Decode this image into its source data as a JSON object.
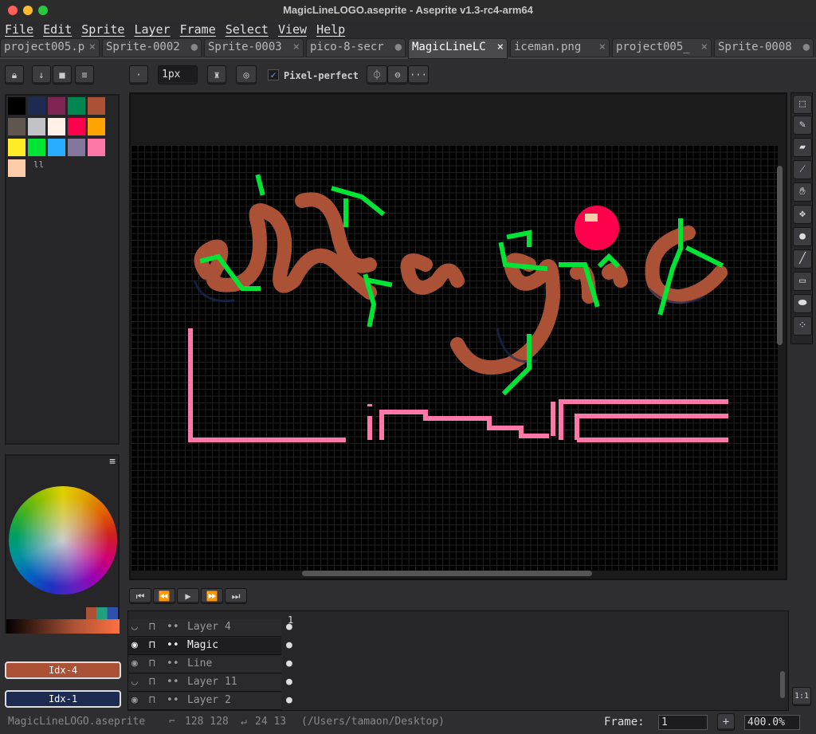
{
  "window": {
    "title": "MagicLineLOGO.aseprite - Aseprite v1.3-rc4-arm64"
  },
  "menu": [
    "File",
    "Edit",
    "Sprite",
    "Layer",
    "Frame",
    "Select",
    "View",
    "Help"
  ],
  "tabs": [
    {
      "label": "project005.p",
      "close": "×"
    },
    {
      "label": "Sprite-0002",
      "close": "●"
    },
    {
      "label": "Sprite-0003",
      "close": "×"
    },
    {
      "label": "pico-8-secr",
      "close": "●"
    },
    {
      "label": "MagicLineLC",
      "close": "×",
      "active": true
    },
    {
      "label": "iceman.png",
      "close": "×"
    },
    {
      "label": "project005_",
      "close": "×"
    },
    {
      "label": "Sprite-0008",
      "close": "●"
    }
  ],
  "toolbar": {
    "brush_size": "1px",
    "pixel_perfect_label": "Pixel-perfect",
    "pixel_perfect_checked": true,
    "more": "···"
  },
  "palette": {
    "colors": [
      "#000000",
      "#1d2b53",
      "#7e2553",
      "#008751",
      "#ab5236",
      "#5f574f",
      "#c2c3c7",
      "#fff1e8",
      "#ff004d",
      "#ffa300",
      "#ffec27",
      "#00e436",
      "#29adff",
      "#83769c",
      "#ff77a8",
      "#ffccaa"
    ]
  },
  "colors": {
    "foreground_label": "Idx-4",
    "foreground": "#ab5236",
    "background_label": "Idx-1",
    "background": "#1d2b53"
  },
  "animation": {
    "buttons": [
      "first-frame",
      "previous-frame",
      "play",
      "next-frame",
      "last-frame"
    ]
  },
  "timeline": {
    "frame_header": "1",
    "layers": [
      {
        "name": "Layer 4",
        "visible": false
      },
      {
        "name": "Magic",
        "visible": true,
        "active": true
      },
      {
        "name": "Line",
        "visible": true
      },
      {
        "name": "Layer 11",
        "visible": false
      },
      {
        "name": "Layer 2",
        "visible": true
      }
    ],
    "zoom_reset": "1:1"
  },
  "status": {
    "filename": "MagicLineLOGO.aseprite",
    "size": "128 128",
    "position": "24 13",
    "path": "(/Users/tamaon/Desktop)",
    "frame_label": "Frame:",
    "frame_value": "1",
    "add": "+",
    "zoom": "400.0%"
  }
}
